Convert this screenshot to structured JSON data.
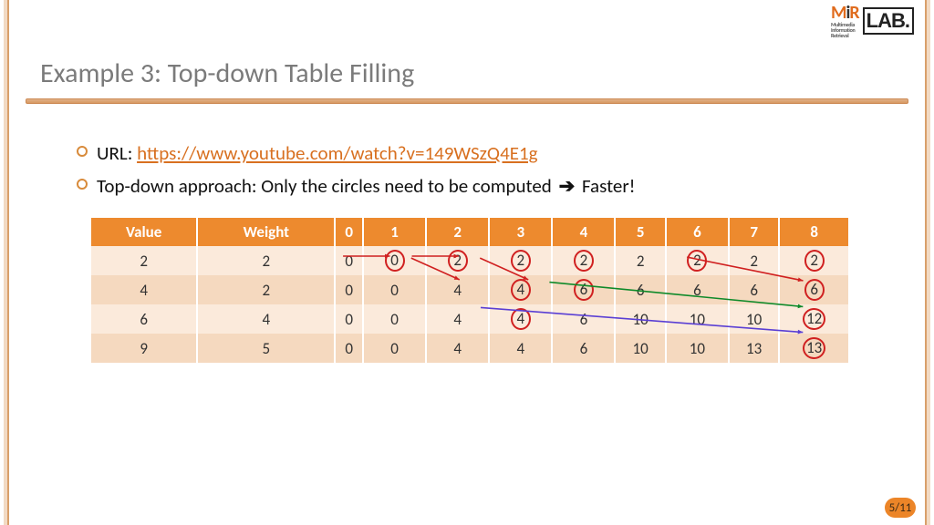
{
  "logo": {
    "mir": "MiR",
    "mir_sub": "Multimedia\nInformation\nRetrieval",
    "lab": "LAB."
  },
  "title": "Example 3: Top-down Table Filling",
  "bullets": {
    "url_label": "URL: ",
    "url": "https://www.youtube.com/watch?v=149WSzQ4E1g",
    "line2_pre": "Top-down approach: Only the circles need to be computed ",
    "arrow": "➔",
    "line2_post": " Faster!"
  },
  "table": {
    "headers": [
      "Value",
      "Weight",
      "0",
      "1",
      "2",
      "3",
      "4",
      "5",
      "6",
      "7",
      "8"
    ],
    "rows": [
      {
        "value": 2,
        "weight": 2,
        "cells": [
          0,
          0,
          2,
          2,
          2,
          2,
          2,
          2,
          2
        ],
        "circled": [
          1,
          2,
          3,
          4,
          6,
          8
        ]
      },
      {
        "value": 4,
        "weight": 2,
        "cells": [
          0,
          0,
          4,
          4,
          6,
          6,
          6,
          6,
          6
        ],
        "circled": [
          3,
          4,
          8
        ]
      },
      {
        "value": 6,
        "weight": 4,
        "cells": [
          0,
          0,
          4,
          4,
          6,
          10,
          10,
          10,
          12
        ],
        "circled": [
          3,
          8
        ]
      },
      {
        "value": 9,
        "weight": 5,
        "cells": [
          0,
          0,
          4,
          4,
          6,
          10,
          10,
          13,
          13
        ],
        "circled": [
          8
        ]
      }
    ]
  },
  "arrows": [
    {
      "color": "#d02020",
      "from": [
        1,
        0
      ],
      "to": [
        2,
        0
      ]
    },
    {
      "color": "#d02020",
      "from": [
        2,
        0
      ],
      "to": [
        3,
        0
      ]
    },
    {
      "color": "#d02020",
      "from": [
        2,
        0
      ],
      "to": [
        3,
        1
      ]
    },
    {
      "color": "#d02020",
      "from": [
        3,
        0
      ],
      "to": [
        4,
        1
      ]
    },
    {
      "color": "#d02020",
      "from": [
        6,
        0
      ],
      "to": [
        8,
        1
      ]
    },
    {
      "color": "#0f8a2a",
      "from": [
        4,
        1
      ],
      "to": [
        8,
        2
      ]
    },
    {
      "color": "#5a3fd4",
      "from": [
        3,
        2
      ],
      "to": [
        8,
        3
      ]
    }
  ],
  "page_num": "5/11"
}
